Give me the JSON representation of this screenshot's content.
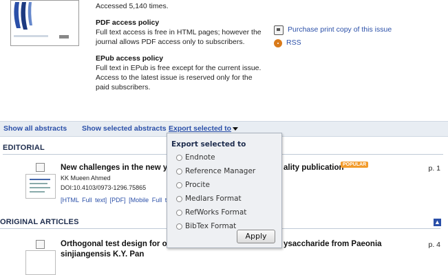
{
  "issue": {
    "accessed": "Accessed 5,140 times.",
    "pdf_policy": {
      "heading": "PDF access policy",
      "text": "Full text access is free in HTML pages; however the journal allows PDF access only to subscribers."
    },
    "epub_policy": {
      "heading": "EPub access policy",
      "text": "Full text in EPub is free except for the current issue. Access to the latest issue is reserved only for the paid subscribers."
    }
  },
  "side_links": {
    "purchase": "Purchase print copy of this issue",
    "rss": "RSS"
  },
  "toolbar": {
    "show_all": "Show all abstracts",
    "show_selected": "Show selected abstracts",
    "export": "Export selected to"
  },
  "sections": {
    "editorial": "EDITORIAL",
    "original": "ORIGINAL ARTICLES"
  },
  "articles": [
    {
      "title_left": "New challenges in the new ye",
      "title_right": "ality publication",
      "badge": "POPULAR",
      "authors": "KK Mueen Ahmed",
      "doi": "DOI:10.4103/0973-1296.75865",
      "links": "[HTML Full text]  [PDF]  [Mobile Full text]",
      "page": "p. 1"
    },
    {
      "title_left": "Orthogonal test design for opti",
      "title_right": "ysaccharide from Paeonia",
      "title_line2": "sinjiangensis K.Y. Pan",
      "page": "p. 4"
    }
  ],
  "dropdown": {
    "heading": "Export selected to",
    "options": [
      "Endnote",
      "Reference Manager",
      "Procite",
      "Medlars Format",
      "RefWorks Format",
      "BibTex Format"
    ],
    "apply": "Apply"
  }
}
